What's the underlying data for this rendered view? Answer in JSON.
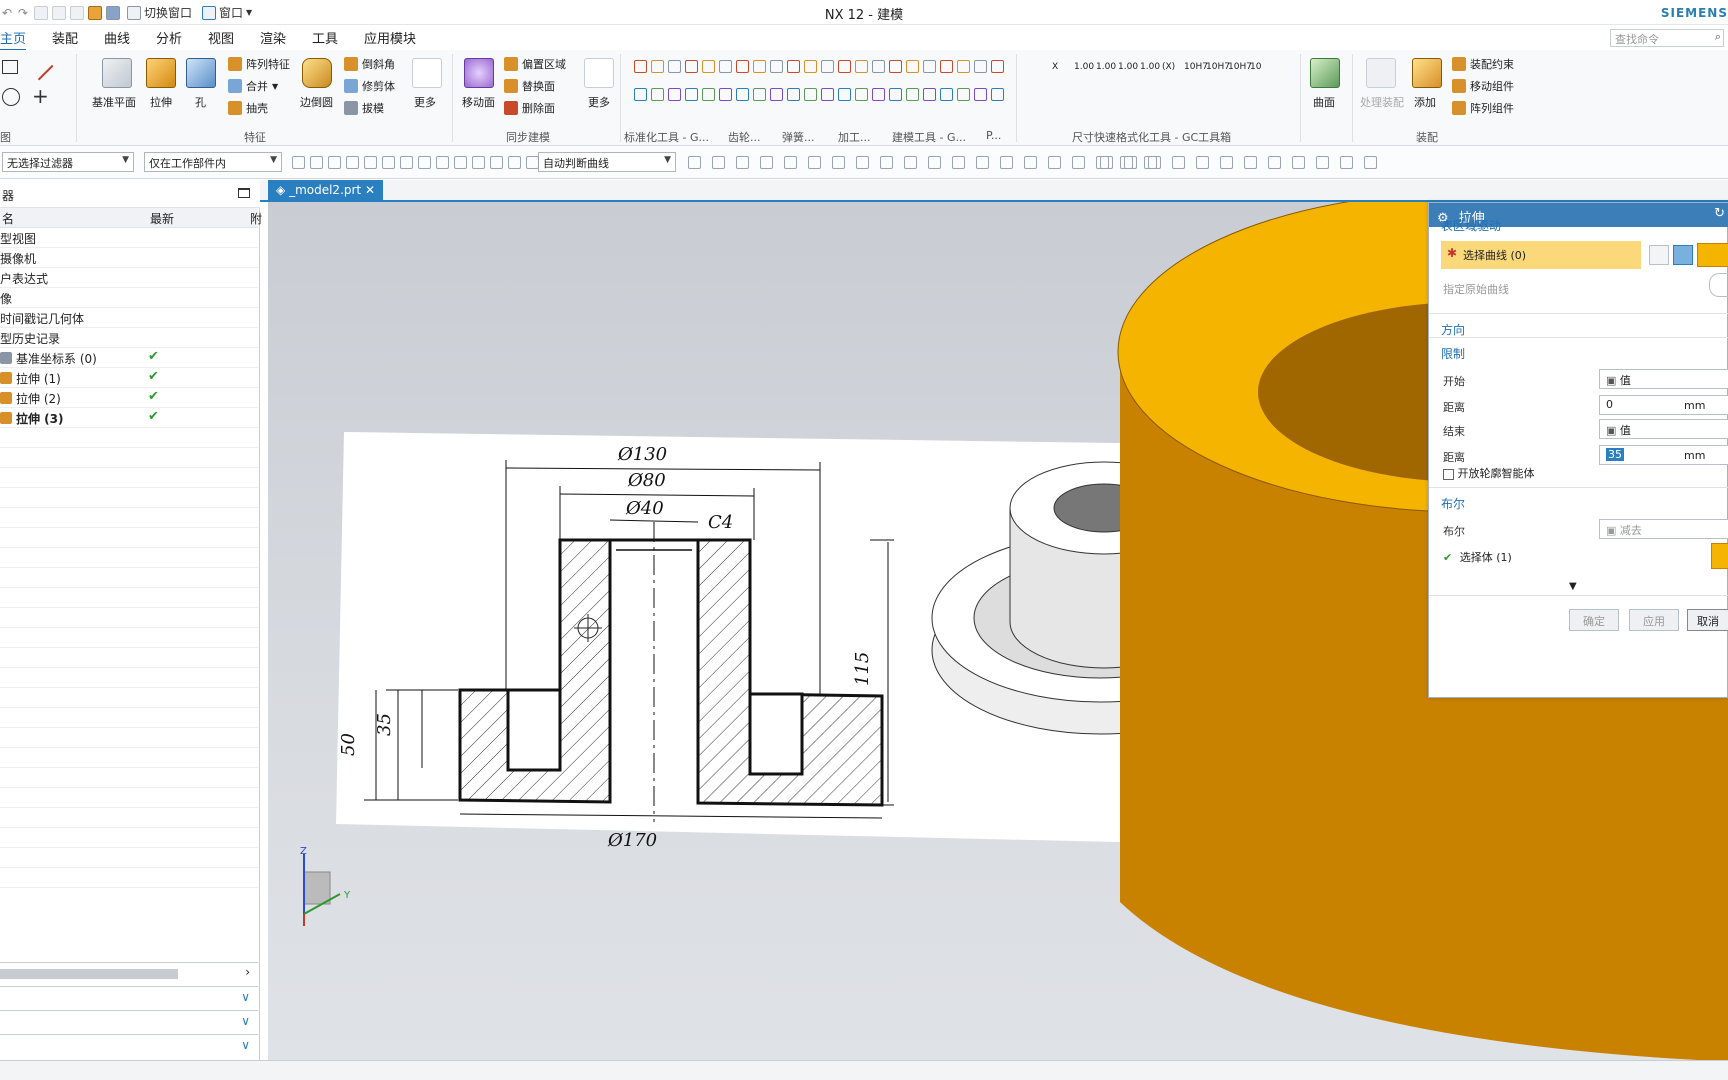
{
  "titlebar": {
    "switch_window": "切换窗口",
    "window_menu": "窗口",
    "app_title": "NX 12 - 建模",
    "brand": "SIEMENS"
  },
  "menubar": {
    "tabs": [
      "主页",
      "装配",
      "曲线",
      "分析",
      "视图",
      "渲染",
      "工具",
      "应用模块"
    ],
    "search_placeholder": "查找命令"
  },
  "ribbon": {
    "group_direct_label": "图",
    "feature": {
      "datum_plane": "基准平面",
      "extrude": "拉伸",
      "hole": "孔",
      "pattern_feature": "阵列特征",
      "unite": "合并",
      "shell": "抽壳",
      "edge_blend": "边倒圆",
      "chamfer": "倒斜角",
      "trim_body": "修剪体",
      "draft": "拔模",
      "more": "更多",
      "group_label": "特征"
    },
    "sync": {
      "move_face": "移动面",
      "offset_region": "偏置区域",
      "replace_face": "替换面",
      "delete_face": "删除面",
      "more": "更多",
      "group_label": "同步建模"
    },
    "groups": {
      "std_tools": "标准化工具 - G...",
      "gear": "齿轮...",
      "spring": "弹簧...",
      "machining": "加工...",
      "modeling_tools": "建模工具 - G...",
      "p": "P...",
      "dimension_tools": "尺寸快速格式化工具 - GC工具箱",
      "surface": "曲面",
      "assembly": "装配"
    },
    "assembly": {
      "process": "处理装配",
      "add": "添加",
      "constraint": "装配约束",
      "move_component": "移动组件",
      "pattern_component": "阵列组件"
    },
    "dim_labels": [
      "X",
      "1.00",
      "1.00",
      "1.00",
      "1.00",
      "(X)",
      "10H7",
      "10H7",
      "10H7",
      "10"
    ]
  },
  "toolbar2": {
    "filter": "无选择过滤器",
    "scope": "仅在工作部件内",
    "curve_rule": "自动判断曲线"
  },
  "navigator": {
    "title": "器",
    "columns": [
      "名",
      "最新",
      "附"
    ],
    "rows": [
      {
        "name": "型视图",
        "check": false
      },
      {
        "name": "摄像机",
        "check": false
      },
      {
        "name": "户表达式",
        "check": false
      },
      {
        "name": "像",
        "check": false
      },
      {
        "name": "时间戳记几何体",
        "check": false
      },
      {
        "name": "型历史记录",
        "check": false
      },
      {
        "name": "基准坐标系 (0)",
        "check": true
      },
      {
        "name": "拉伸 (1)",
        "check": true
      },
      {
        "name": "拉伸 (2)",
        "check": true
      },
      {
        "name": "拉伸 (3)",
        "check": true
      }
    ],
    "check_mark": "✔"
  },
  "document": {
    "tab": "_model2.prt"
  },
  "drawing": {
    "dims": {
      "d130": "Ø130",
      "d80": "Ø80",
      "d40": "Ø40",
      "c4": "C4",
      "d170": "Ø170",
      "h115": "115",
      "h50": "50",
      "h35": "35"
    }
  },
  "triad": {
    "z": "Z",
    "y": "Y"
  },
  "dialog": {
    "title": "拉伸",
    "section_drive": "表区域驱动",
    "select_curve": "选择曲线 (0)",
    "specify_curve": "指定原始曲线",
    "direction": "方向",
    "limits": "限制",
    "start_label": "开始",
    "start_value": "值",
    "distance_label": "距离",
    "start_distance": "0",
    "unit": "mm",
    "end_label": "结束",
    "end_value": "值",
    "end_distance": "35",
    "open_profile": "开放轮廓智能体",
    "boolean_section": "布尔",
    "boolean_label": "布尔",
    "boolean_value": "减去",
    "select_body": "选择体 (1)",
    "ok": "确定",
    "apply": "应用",
    "cancel": "取消"
  },
  "colors": {
    "accent": "#2a7fc0",
    "orange_top": "#f5b400",
    "orange_side": "#d08a00",
    "highlight": "#fbd97a"
  }
}
